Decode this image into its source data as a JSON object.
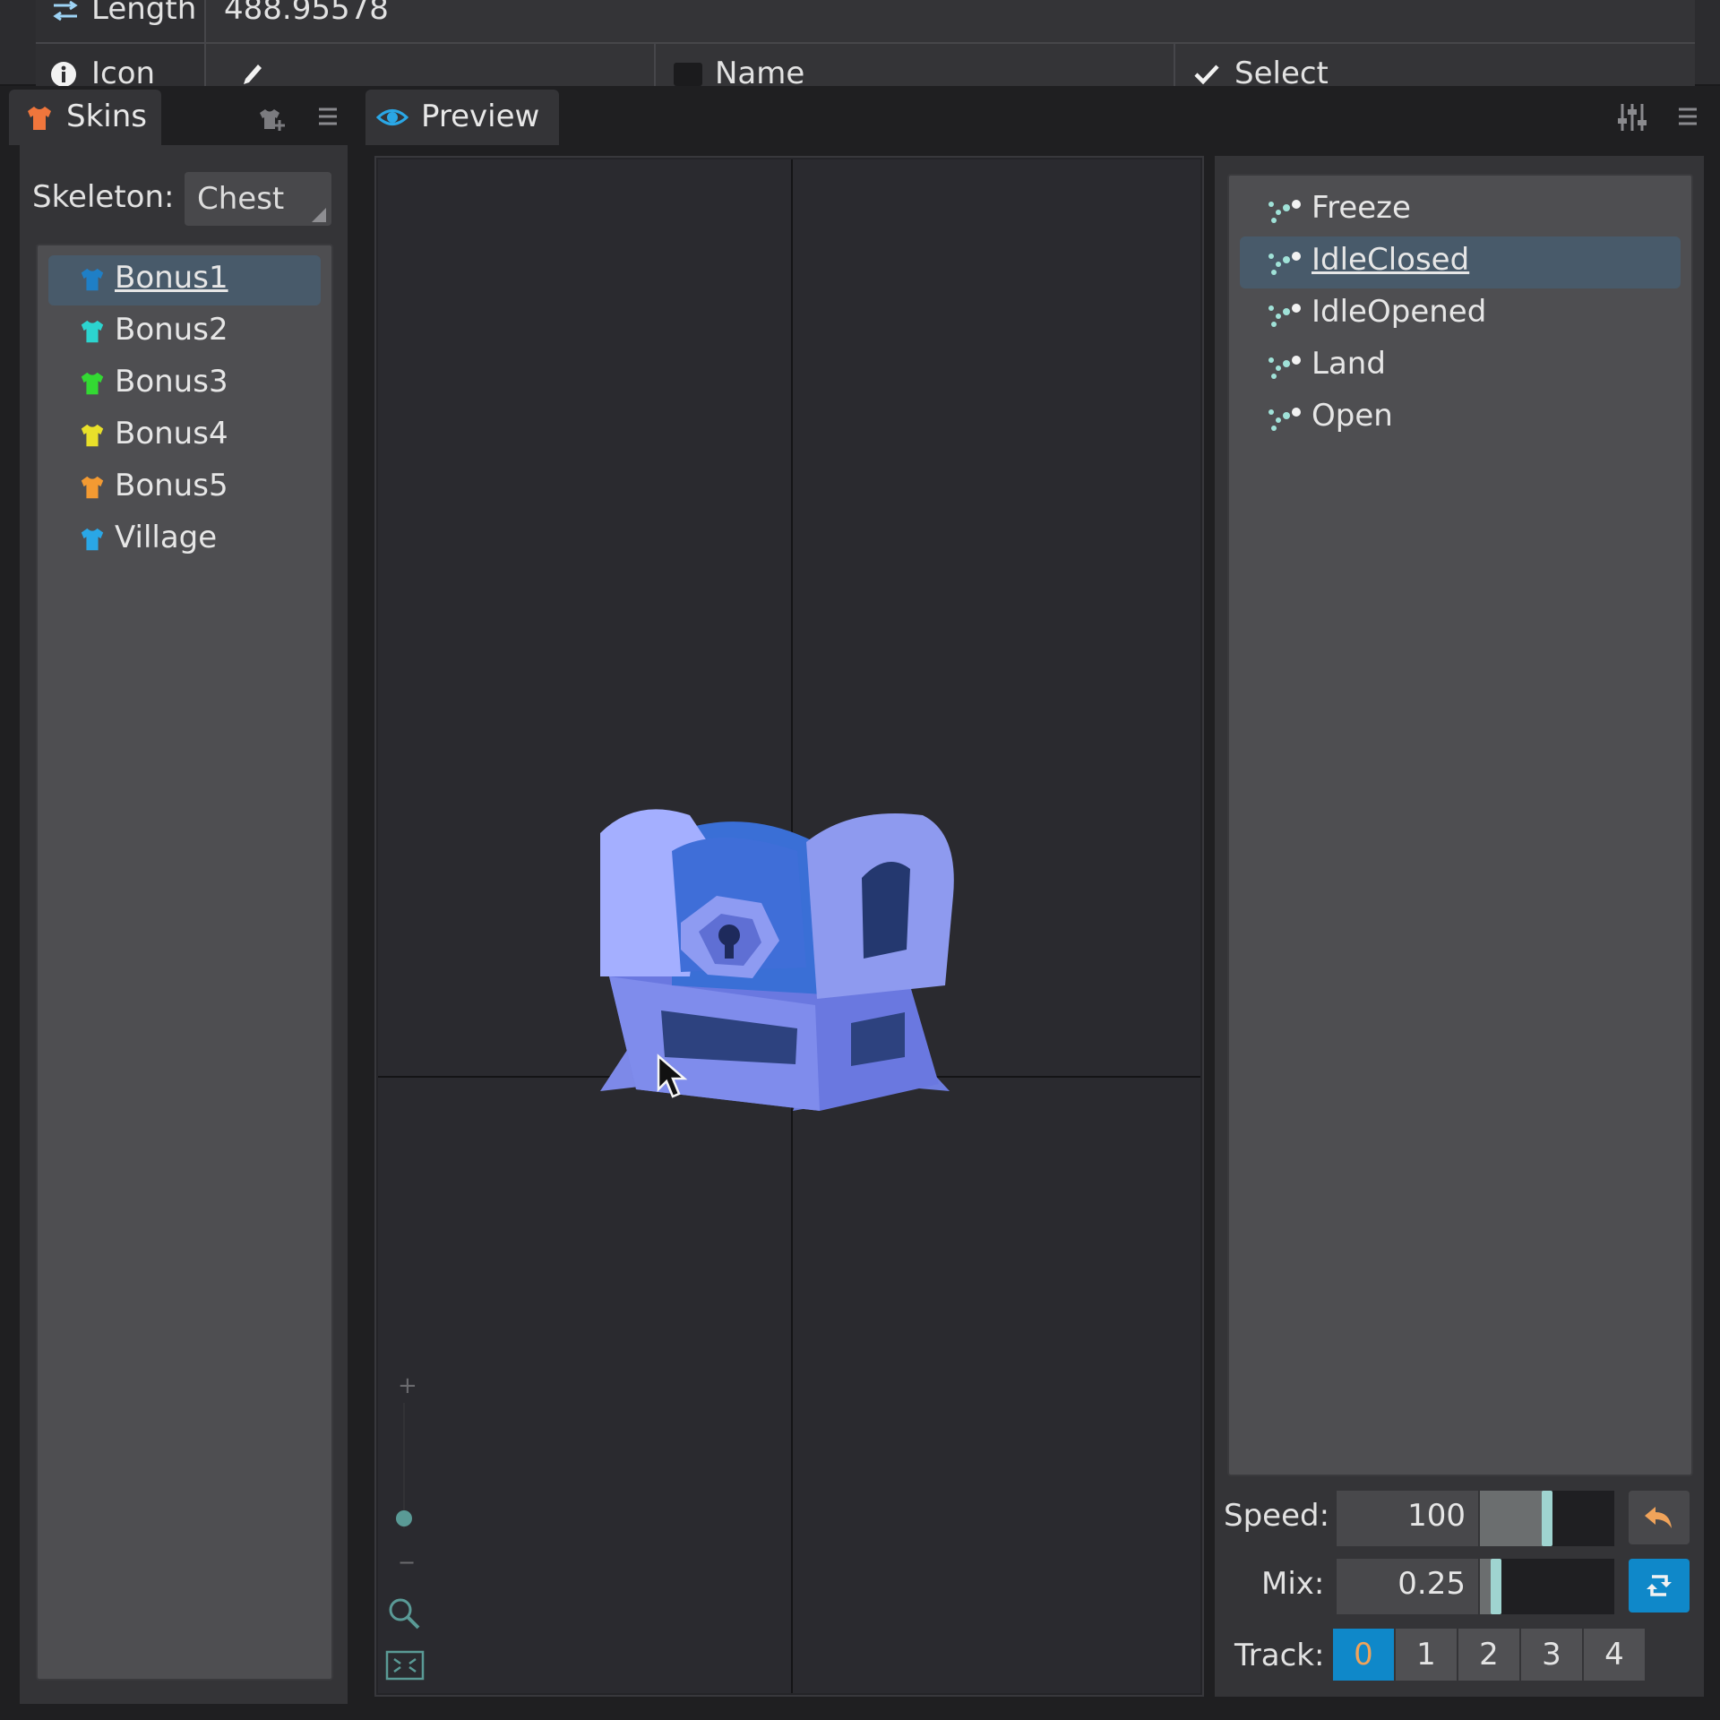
{
  "properties": {
    "length_label": "Length",
    "length_value": "488.95578",
    "icon_label": "Icon",
    "name_label": "Name",
    "select_label": "Select"
  },
  "tabs": {
    "skins": "Skins",
    "preview": "Preview"
  },
  "skins": {
    "skeleton_label": "Skeleton:",
    "skeleton_value": "Chest",
    "items": [
      {
        "label": "Bonus1",
        "color": "#1f7fc6",
        "selected": true
      },
      {
        "label": "Bonus2",
        "color": "#2cd4cf"
      },
      {
        "label": "Bonus3",
        "color": "#33d933"
      },
      {
        "label": "Bonus4",
        "color": "#e9e02a"
      },
      {
        "label": "Bonus5",
        "color": "#f39a32"
      },
      {
        "label": "Village",
        "color": "#2aa7e6"
      }
    ]
  },
  "animations": {
    "items": [
      {
        "label": "Freeze"
      },
      {
        "label": "IdleClosed",
        "selected": true
      },
      {
        "label": "IdleOpened"
      },
      {
        "label": "Land"
      },
      {
        "label": "Open"
      }
    ]
  },
  "controls": {
    "speed_label": "Speed:",
    "speed_value": "100",
    "speed_fraction": 0.5,
    "mix_label": "Mix:",
    "mix_value": "0.25",
    "mix_fraction": 0.12,
    "track_label": "Track:",
    "tracks": [
      "0",
      "1",
      "2",
      "3",
      "4"
    ],
    "active_track": "0"
  },
  "colors": {
    "accent": "#0f88c9",
    "selection": "#485a6a",
    "back_button": "#f0a35a",
    "chest": "#6a78e0"
  }
}
